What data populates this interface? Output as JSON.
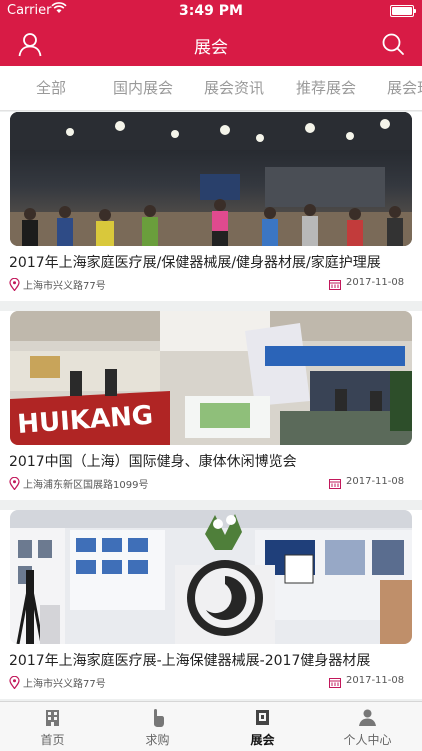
{
  "status_bar": {
    "carrier": "Carrier",
    "time": "3:49 PM"
  },
  "header": {
    "title": "展会"
  },
  "tabs": [
    {
      "label": "全部"
    },
    {
      "label": "国内展会"
    },
    {
      "label": "展会资讯"
    },
    {
      "label": "推荐展会"
    },
    {
      "label": "展会现"
    }
  ],
  "exhibitions": [
    {
      "title": "2017年上海家庭医疗展/保健器械展/健身器材展/家庭护理展",
      "location": "上海市兴义路77号",
      "date": "2017-11-08"
    },
    {
      "title": "2017中国（上海）国际健身、康体休闲博览会",
      "location": "上海浦东新区国展路1099号",
      "date": "2017-11-08",
      "image_text": "HUIKANG"
    },
    {
      "title": "2017年上海家庭医疗展-上海保健器械展-2017健身器材展",
      "location": "上海市兴义路77号",
      "date": "2017-11-08"
    }
  ],
  "tabbar": [
    {
      "label": "首页",
      "icon": "building-icon"
    },
    {
      "label": "求购",
      "icon": "hand-pointer-icon"
    },
    {
      "label": "展会",
      "icon": "exhibition-icon",
      "active": true
    },
    {
      "label": "个人中心",
      "icon": "person-icon"
    }
  ],
  "colors": {
    "brand": "#d81b45",
    "background": "#eef0f0"
  }
}
